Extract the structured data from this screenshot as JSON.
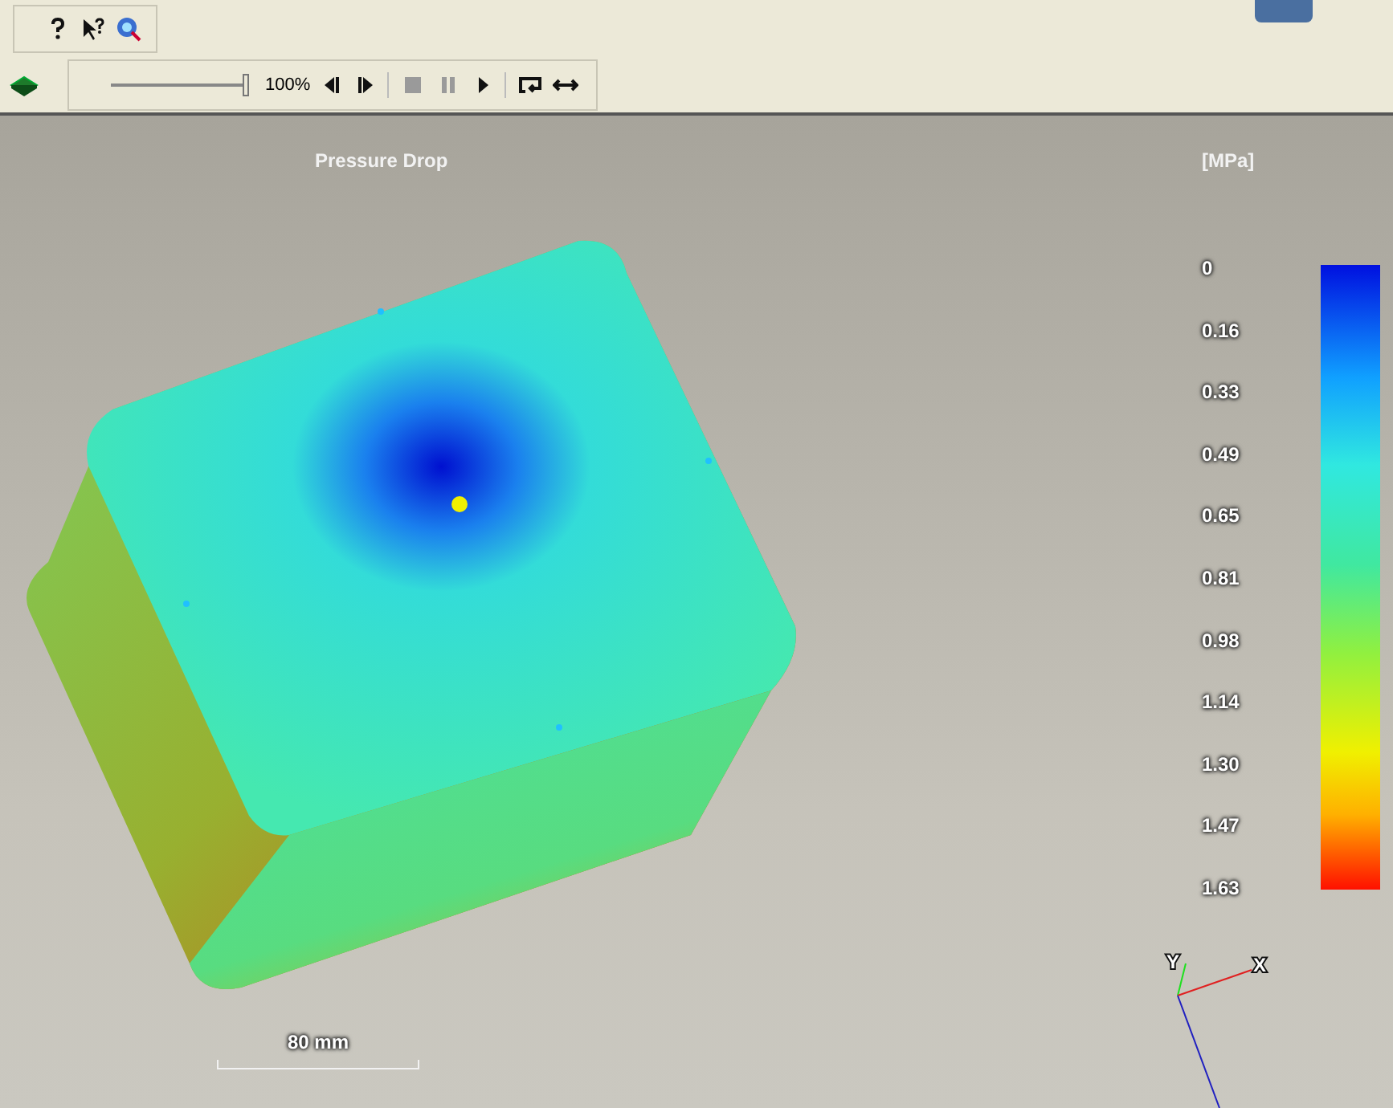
{
  "help_toolbar": {
    "buttons": [
      {
        "kind": "help"
      },
      {
        "kind": "whats_this"
      },
      {
        "kind": "web_search"
      }
    ]
  },
  "animation_toolbar": {
    "slider": {
      "level": 1
    },
    "zoom": "100%",
    "buttons": [
      {
        "kind": "step_back",
        "disabled": false
      },
      {
        "kind": "step_forward",
        "disabled": false
      },
      {
        "kind": "stop",
        "disabled": true
      },
      {
        "kind": "pause",
        "disabled": true
      },
      {
        "kind": "play",
        "disabled": false
      },
      {
        "kind": "loop",
        "disabled": false
      },
      {
        "kind": "bounce",
        "disabled": false
      }
    ]
  },
  "viewport": {
    "title": "Pressure Drop",
    "unit": "[MPa]",
    "legend": {
      "ticks": [
        "0",
        "0.16",
        "0.33",
        "0.49",
        "0.65",
        "0.81",
        "0.98",
        "1.14",
        "1.30",
        "1.47",
        "1.63"
      ]
    },
    "scale_bar": "80 mm",
    "axes": {
      "x": "X",
      "y": "Y"
    }
  }
}
